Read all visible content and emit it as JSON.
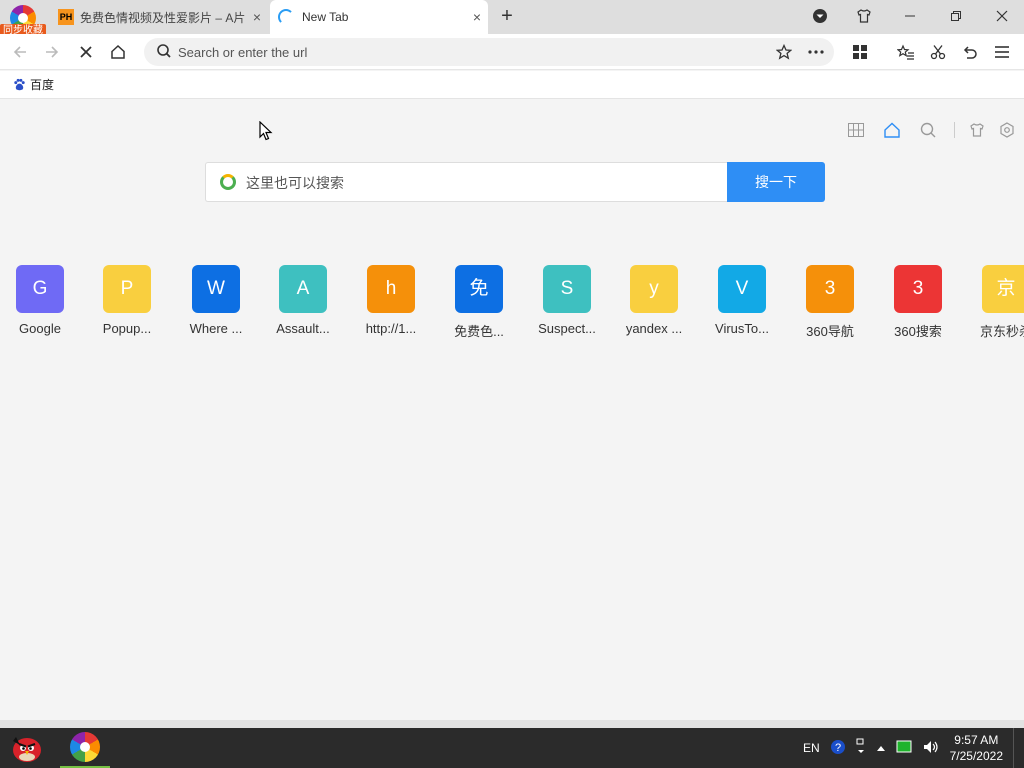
{
  "browser": {
    "sync_badge": "同步收藏",
    "tabs": [
      {
        "favicon": "PH",
        "title": "免费色情视频及性爱影片 – A片",
        "close": "×"
      },
      {
        "favicon": "loading-spinner",
        "title": "New Tab",
        "close": "×"
      }
    ],
    "new_tab": "+"
  },
  "navbar": {
    "address_placeholder": "Search or enter the url",
    "address_value": ""
  },
  "bookmarks": [
    {
      "icon": "baidu-paw-icon",
      "label": "百度"
    }
  ],
  "page": {
    "search_placeholder": "这里也可以搜索",
    "search_button": "搜一下",
    "tiles": [
      {
        "letter": "G",
        "label": "Google",
        "color": "#6f6af5"
      },
      {
        "letter": "P",
        "label": "Popup...",
        "color": "#f9cf3f"
      },
      {
        "letter": "W",
        "label": "Where ...",
        "color": "#0d6fe3"
      },
      {
        "letter": "A",
        "label": "Assault...",
        "color": "#3ec0c0"
      },
      {
        "letter": "h",
        "label": "http://1...",
        "color": "#f5900a"
      },
      {
        "letter": "免",
        "label": "免费色...",
        "color": "#0d6fe3"
      },
      {
        "letter": "S",
        "label": "Suspect...",
        "color": "#3ec0c0"
      },
      {
        "letter": "y",
        "label": "yandex ...",
        "color": "#f9cf3f"
      },
      {
        "letter": "V",
        "label": "VirusTo...",
        "color": "#12a9e6"
      },
      {
        "letter": "3",
        "label": "360导航",
        "color": "#f5900a"
      },
      {
        "letter": "3",
        "label": "360搜索",
        "color": "#ec3535"
      },
      {
        "letter": "京",
        "label": "京东秒杀",
        "color": "#f9cf3f"
      }
    ]
  },
  "taskbar": {
    "lang": "EN",
    "time": "9:57 AM",
    "date": "7/25/2022"
  }
}
